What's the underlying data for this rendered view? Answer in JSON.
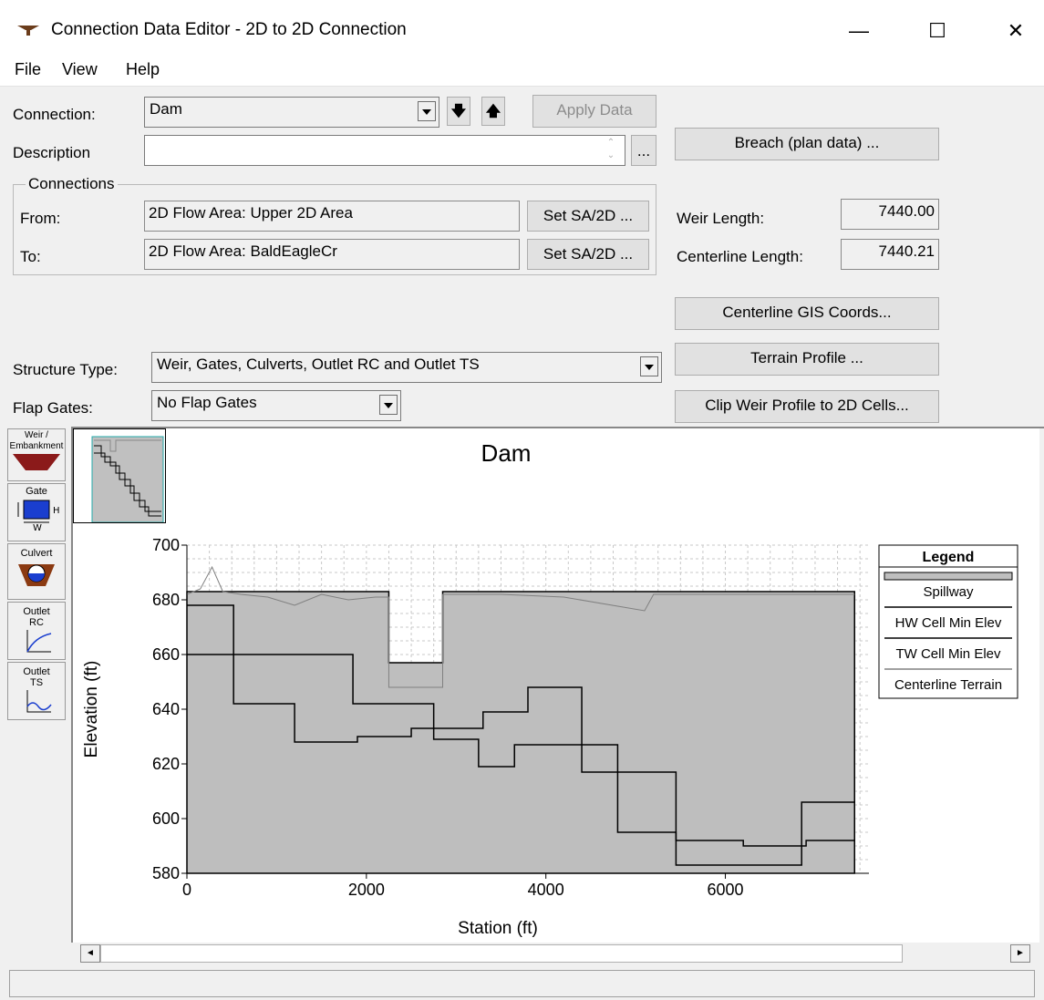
{
  "window": {
    "title": "Connection Data Editor - 2D to 2D Connection",
    "minimize": "—",
    "maximize": "☐",
    "close": "✕"
  },
  "menu": [
    "File",
    "View",
    "Help"
  ],
  "form": {
    "connection_label": "Connection:",
    "connection_value": "Dam",
    "apply_label": "Apply Data",
    "description_label": "Description",
    "description_value": "",
    "ellipsis": "...",
    "breach_label": "Breach (plan data) ...",
    "connections_group": "Connections",
    "from_label": "From:",
    "from_value": "2D Flow Area: Upper 2D Area",
    "to_label": "To:",
    "to_value": "2D Flow Area: BaldEagleCr",
    "set_sa_label": "Set SA/2D ...",
    "weir_length_label": "Weir Length:",
    "weir_length_value": "7440.00",
    "centerline_length_label": "Centerline Length:",
    "centerline_length_value": "7440.21",
    "centerline_gis_label": "Centerline GIS Coords...",
    "terrain_profile_label": "Terrain Profile ...",
    "clip_weir_label": "Clip Weir Profile to 2D Cells...",
    "structure_type_label": "Structure Type:",
    "structure_type_value": "Weir, Gates, Culverts, Outlet RC and Outlet TS",
    "flap_gates_label": "Flap Gates:",
    "flap_gates_value": "No Flap Gates"
  },
  "toolbar": {
    "weir": "Weir / Embankment",
    "gate": "Gate",
    "culvert": "Culvert",
    "outlet_rc": "Outlet RC",
    "outlet_ts": "Outlet TS"
  },
  "chart_data": {
    "type": "line",
    "title": "Dam",
    "xlabel": "Station (ft)",
    "ylabel": "Elevation (ft)",
    "xlim": [
      0,
      7600
    ],
    "ylim": [
      580,
      700
    ],
    "xticks": [
      0,
      2000,
      4000,
      6000
    ],
    "yticks": [
      580,
      600,
      620,
      640,
      660,
      680,
      700
    ],
    "grid": true,
    "legend_position": "right",
    "legend_title": "Legend",
    "series": [
      {
        "name": "Spillway",
        "color": "#bebebe",
        "x": [
          0,
          0,
          2250,
          2250,
          2850,
          2850,
          7440,
          7440
        ],
        "y": [
          580,
          683,
          683,
          657,
          657,
          683,
          683,
          580
        ]
      },
      {
        "name": "HW Cell Min Elev",
        "color": "#000000",
        "x": [
          0,
          520,
          520,
          1200,
          1200,
          1900,
          1900,
          2500,
          2500,
          3300,
          3300,
          3800,
          3800,
          4400,
          4400,
          5450,
          5450,
          6850,
          6850,
          7440
        ],
        "y": [
          678,
          678,
          642,
          642,
          628,
          628,
          630,
          630,
          633,
          633,
          639,
          639,
          648,
          648,
          617,
          617,
          583,
          583,
          606,
          606
        ]
      },
      {
        "name": "TW Cell Min Elev",
        "color": "#000000",
        "x": [
          0,
          1850,
          1850,
          2750,
          2750,
          3250,
          3250,
          3650,
          3650,
          4100,
          4100,
          4800,
          4800,
          5450,
          5450,
          6200,
          6200,
          6900,
          6900,
          7440
        ],
        "y": [
          660,
          660,
          642,
          642,
          629,
          629,
          619,
          619,
          627,
          627,
          627,
          627,
          595,
          595,
          592,
          592,
          590,
          590,
          592,
          592
        ]
      },
      {
        "name": "Centerline Terrain",
        "color": "#808080",
        "x": [
          0,
          150,
          280,
          400,
          600,
          900,
          1200,
          1500,
          1800,
          2100,
          2250,
          2250,
          2850,
          2850,
          3500,
          4200,
          5100,
          5200,
          5800,
          6500,
          7440
        ],
        "y": [
          682,
          684,
          692,
          683,
          682,
          681,
          678,
          682,
          680,
          681,
          681,
          648,
          648,
          682,
          682,
          681,
          676,
          682,
          682,
          682,
          682
        ]
      }
    ]
  },
  "scroll": {
    "left_arrow": "◄",
    "right_arrow": "►",
    "up_arrow": "▲",
    "down_arrow": "▼"
  },
  "status": {
    "text": ""
  }
}
